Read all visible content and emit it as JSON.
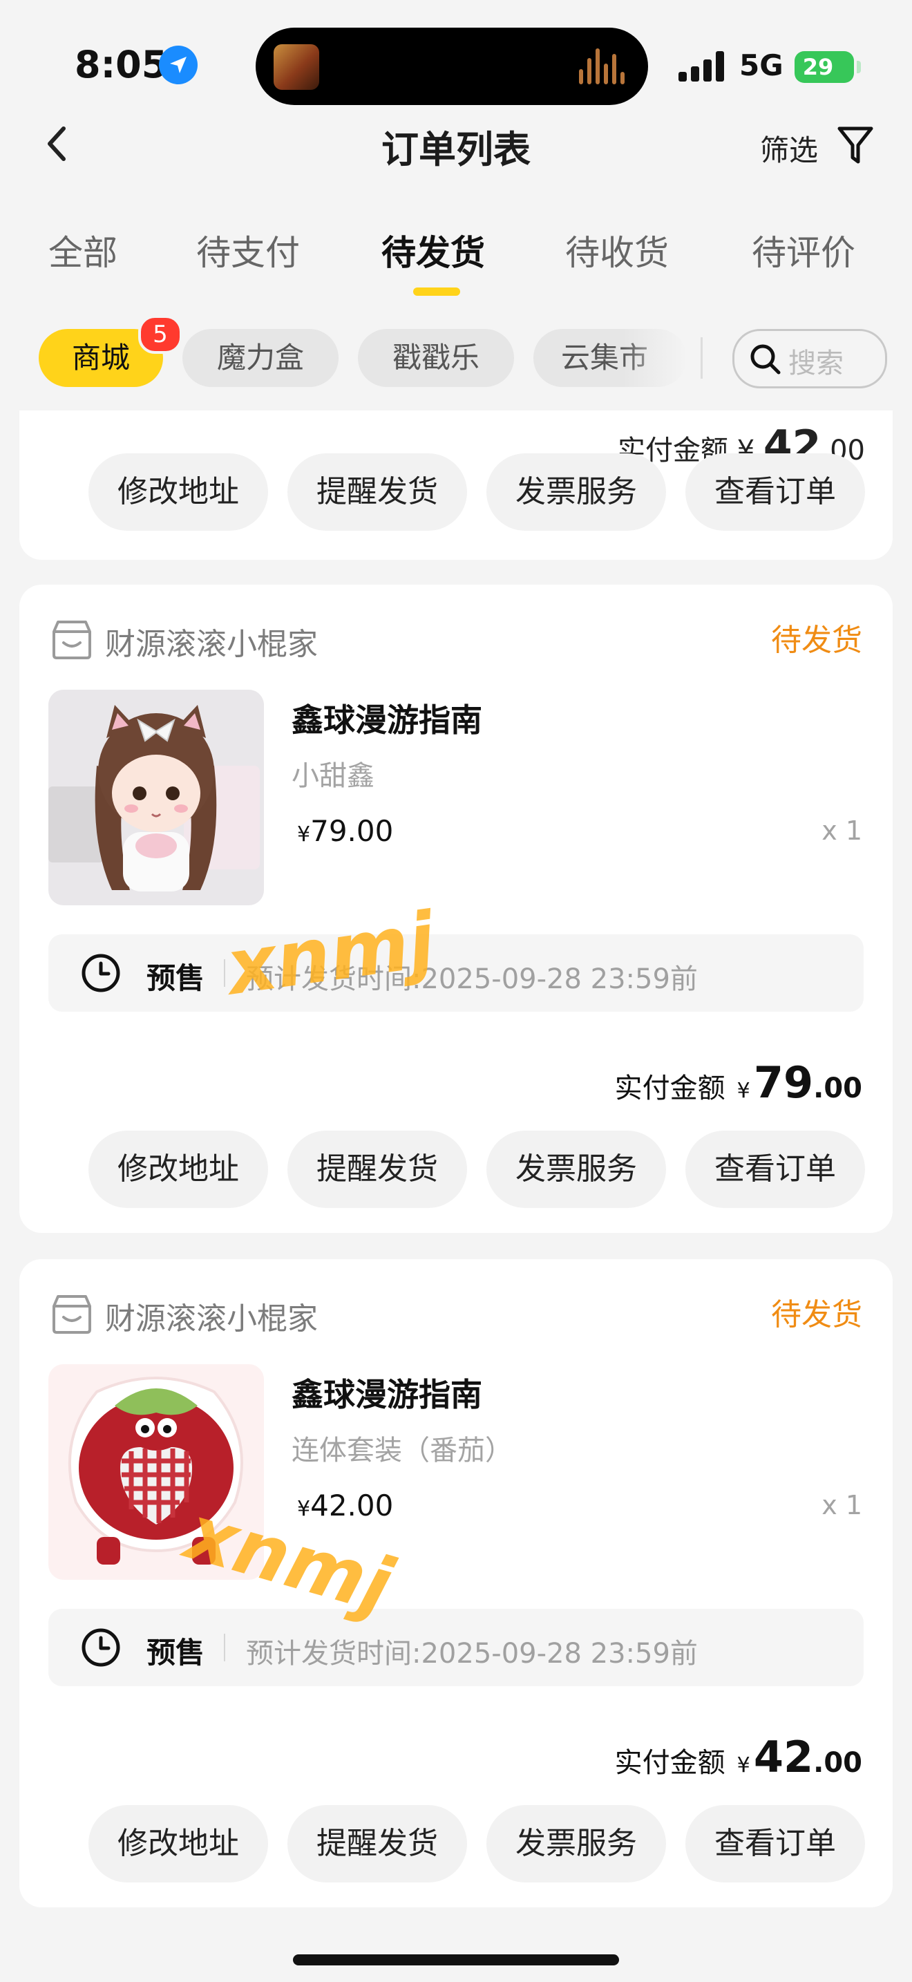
{
  "status_bar": {
    "time": "8:05",
    "network": "5G",
    "battery": "29"
  },
  "header": {
    "title": "订单列表",
    "filter_label": "筛选"
  },
  "tabs": [
    {
      "label": "全部",
      "active": false
    },
    {
      "label": "待支付",
      "active": false
    },
    {
      "label": "待发货",
      "active": true
    },
    {
      "label": "待收货",
      "active": false
    },
    {
      "label": "待评价",
      "active": false
    }
  ],
  "categories": [
    {
      "label": "商城",
      "active": true,
      "badge": "5"
    },
    {
      "label": "魔力盒",
      "active": false
    },
    {
      "label": "戳戳乐",
      "active": false
    },
    {
      "label": "云集市",
      "active": false
    }
  ],
  "search": {
    "placeholder": "搜索"
  },
  "partial_card": {
    "amount_label": "实付金额",
    "amount_yen": "¥",
    "amount_int": "42",
    "amount_dec": ".00",
    "buttons": [
      "修改地址",
      "提醒发货",
      "发票服务",
      "查看订单"
    ]
  },
  "orders": [
    {
      "shop": "财源滚滚小棍家",
      "status": "待发货",
      "product_title": "鑫球漫游指南",
      "product_spec": "小甜鑫",
      "price_yen": "¥",
      "price": "79.00",
      "qty": "x 1",
      "presale_label": "预售",
      "presale_text": "预计发货时间:2025-09-28 23:59前",
      "amount_label": "实付金额",
      "amount_yen": "¥",
      "amount_int": "79",
      "amount_dec": ".00",
      "buttons": [
        "修改地址",
        "提醒发货",
        "发票服务",
        "查看订单"
      ]
    },
    {
      "shop": "财源滚滚小棍家",
      "status": "待发货",
      "product_title": "鑫球漫游指南",
      "product_spec": "连体套装（番茄）",
      "price_yen": "¥",
      "price": "42.00",
      "qty": "x 1",
      "presale_label": "预售",
      "presale_text": "预计发货时间:2025-09-28 23:59前",
      "amount_label": "实付金额",
      "amount_yen": "¥",
      "amount_int": "42",
      "amount_dec": ".00",
      "buttons": [
        "修改地址",
        "提醒发货",
        "发票服务",
        "查看订单"
      ]
    }
  ],
  "watermark": "xnmj",
  "colors": {
    "accent_yellow": "#ffd31a",
    "status_orange": "#f08c14",
    "badge_red": "#ff3a2e"
  },
  "icons": [
    "location-arrow-icon",
    "back-chevron-icon",
    "filter-funnel-icon",
    "search-icon",
    "shop-icon",
    "clock-icon"
  ]
}
